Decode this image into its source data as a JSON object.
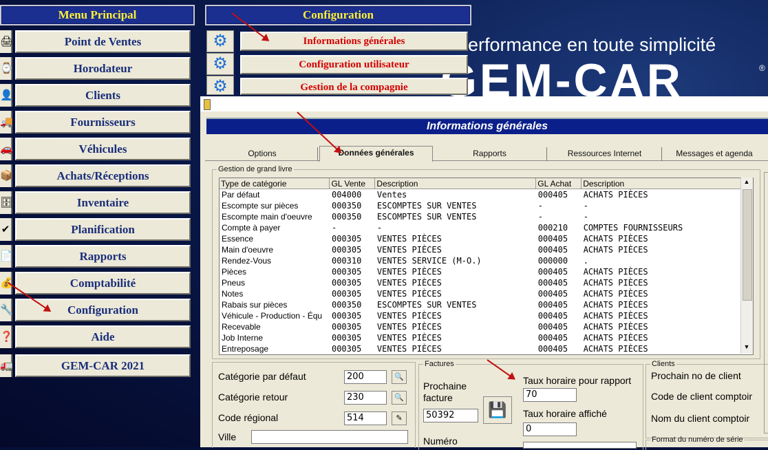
{
  "menu_principal": {
    "title": "Menu Principal",
    "items": [
      {
        "label": "Point de Ventes",
        "icon": "register-icon"
      },
      {
        "label": "Horodateur",
        "icon": "clock-icon"
      },
      {
        "label": "Clients",
        "icon": "person-icon"
      },
      {
        "label": "Fournisseurs",
        "icon": "supplier-icon"
      },
      {
        "label": "Véhicules",
        "icon": "car-icon"
      },
      {
        "label": "Achats/Réceptions",
        "icon": "box-icon"
      },
      {
        "label": "Inventaire",
        "icon": "inventory-icon"
      },
      {
        "label": "Planification",
        "icon": "check-icon"
      },
      {
        "label": "Rapports",
        "icon": "report-icon"
      },
      {
        "label": "Comptabilité",
        "icon": "money-icon"
      },
      {
        "label": "Configuration",
        "icon": "tools-icon"
      },
      {
        "label": "Aide",
        "icon": "help-icon"
      },
      {
        "label": "GEM-CAR 2021",
        "icon": "truck-icon"
      }
    ]
  },
  "configuration_menu": {
    "title": "Configuration",
    "items": [
      {
        "label": "Informations générales"
      },
      {
        "label": "Configuration utilisateur"
      },
      {
        "label": "Gestion de la compagnie"
      }
    ]
  },
  "brand": {
    "slogan": "erformance en toute simplicité",
    "logo": "GEM-CAR",
    "registered": "®"
  },
  "window": {
    "banner": "Informations générales",
    "tabs": [
      "Options",
      "Données générales",
      "Rapports",
      "Ressources Internet",
      "Messages et agenda"
    ],
    "active_tab": "Données générales"
  },
  "grand_livre": {
    "legend": "Gestion de grand livre",
    "columns": [
      "Type de catégorie",
      "GL Vente",
      "Description",
      "GL Achat",
      "Description"
    ],
    "rows": [
      [
        "Par défaut",
        "004000",
        "Ventes",
        "000405",
        "ACHATS PIÈCES"
      ],
      [
        "Escompte sur pièces",
        "000350",
        "ESCOMPTES SUR VENTES",
        "-",
        "-"
      ],
      [
        "Escompte main d'oeuvre",
        "000350",
        "ESCOMPTES SUR VENTES",
        "-",
        "-"
      ],
      [
        "Compte à payer",
        "-",
        "-",
        "000210",
        "COMPTES FOURNISSEURS"
      ],
      [
        "Essence",
        "000305",
        "VENTES PIÈCES",
        "000405",
        "ACHATS PIÈCES"
      ],
      [
        "Main d'oeuvre",
        "000305",
        "VENTES PIÈCES",
        "000405",
        "ACHATS PIÈCES"
      ],
      [
        "Rendez-Vous",
        "000310",
        "VENTES SERVICE (M-O.)",
        "000000",
        "."
      ],
      [
        "Pièces",
        "000305",
        "VENTES PIÈCES",
        "000405",
        "ACHATS PIÈCES"
      ],
      [
        "Pneus",
        "000305",
        "VENTES PIÈCES",
        "000405",
        "ACHATS PIÈCES"
      ],
      [
        "Notes",
        "000305",
        "VENTES PIÈCES",
        "000405",
        "ACHATS PIÈCES"
      ],
      [
        "Rabais sur pièces",
        "000350",
        "ESCOMPTES SUR VENTES",
        "000405",
        "ACHATS PIÈCES"
      ],
      [
        "Véhicule - Production - Équ",
        "000305",
        "VENTES PIÈCES",
        "000405",
        "ACHATS PIÈCES"
      ],
      [
        "Recevable",
        "000305",
        "VENTES PIÈCES",
        "000405",
        "ACHATS PIÈCES"
      ],
      [
        "Job Interne",
        "000305",
        "VENTES PIÈCES",
        "000405",
        "ACHATS PIÈCES"
      ],
      [
        "Entreposage",
        "000305",
        "VENTES PIÈCES",
        "000405",
        "ACHATS PIÈCES"
      ]
    ]
  },
  "left_fields": {
    "categorie_defaut_label": "Catégorie par défaut",
    "categorie_defaut_value": "200",
    "categorie_retour_label": "Catégorie retour",
    "categorie_retour_value": "230",
    "code_regional_label": "Code régional",
    "code_regional_value": "514",
    "ville_label": "Ville",
    "ville_value": ""
  },
  "factures": {
    "legend": "Factures",
    "prochaine_facture_label": "Prochaine facture",
    "prochaine_facture_value": "50392",
    "numero_label": "Numéro",
    "taux_rapport_label": "Taux horaire pour rapport",
    "taux_rapport_value": "70",
    "taux_affiche_label": "Taux horaire affiché",
    "taux_affiche_value": "0"
  },
  "clients": {
    "legend": "Clients",
    "prochain_no_label": "Prochain no de client",
    "code_comptoir_label": "Code de client comptoir",
    "nom_comptoir_label": "Nom du client comptoir",
    "format_serie_legend": "Format du numéro de série"
  }
}
